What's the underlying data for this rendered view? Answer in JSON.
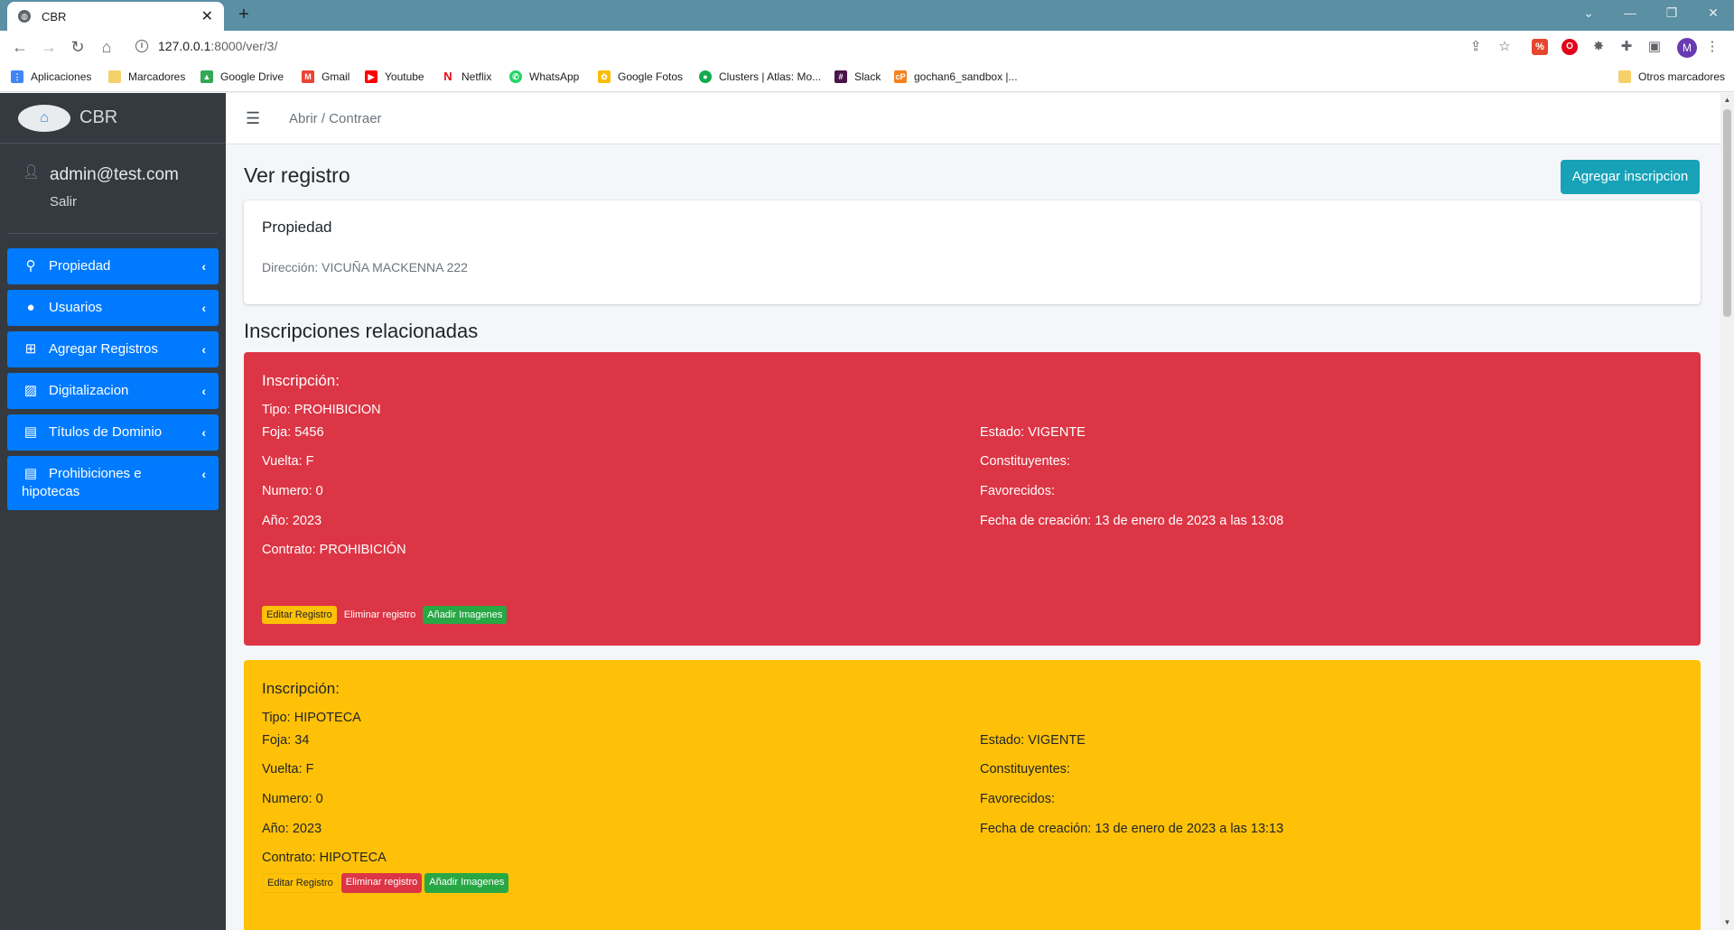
{
  "browser": {
    "tab_title": "CBR",
    "url_host": "127.0.0.1",
    "url_rest": ":8000/ver/3/",
    "bookmarks": [
      "Aplicaciones",
      "Marcadores",
      "Google Drive",
      "Gmail",
      "Youtube",
      "Netflix",
      "WhatsApp",
      "Google Fotos",
      "Clusters | Atlas: Mo...",
      "Slack",
      "gochan6_sandbox |...",
      "Otros marcadores"
    ],
    "profile_initial": "M"
  },
  "sidebar": {
    "brand": "CBR",
    "user": "admin@test.com",
    "logout": "Salir",
    "items": [
      {
        "label": "Propiedad",
        "icon": "search-icon"
      },
      {
        "label": "Usuarios",
        "icon": "user-icon"
      },
      {
        "label": "Agregar Registros",
        "icon": "plus-square-icon"
      },
      {
        "label": "Digitalizacion",
        "icon": "image-icon"
      },
      {
        "label": "Títulos de Dominio",
        "icon": "file-icon"
      },
      {
        "label": "Prohibiciones e hipotecas",
        "icon": "file-icon"
      }
    ]
  },
  "topbar": {
    "breadcrumb": "Abrir / Contraer"
  },
  "page": {
    "title": "Ver registro",
    "add_button": "Agregar inscripcion",
    "property_card": {
      "title": "Propiedad",
      "address": "Dirección: VICUÑA MACKENNA 222"
    },
    "related_title": "Inscripciones relacionadas",
    "inscriptions": [
      {
        "color": "#dc3545",
        "header": "Inscripción:",
        "tipo": "Tipo: PROHIBICION",
        "foja": "Foja: 5456",
        "vuelta": "Vuelta: F",
        "numero": "Numero: 0",
        "anio": "Año: 2023",
        "contrato": "Contrato: PROHIBICIÓN",
        "estado": "Estado: VIGENTE",
        "constituyentes": "Constituyentes:",
        "favorecidos": "Favorecidos:",
        "fecha": "Fecha de creación: 13 de enero de 2023 a las 13:08"
      },
      {
        "color": "#ffc107",
        "header": "Inscripción:",
        "tipo": "Tipo: HIPOTECA",
        "foja": "Foja: 34",
        "vuelta": "Vuelta: F",
        "numero": "Numero: 0",
        "anio": "Año: 2023",
        "contrato": "Contrato: HIPOTECA",
        "estado": "Estado: VIGENTE",
        "constituyentes": "Constituyentes:",
        "favorecidos": "Favorecidos:",
        "fecha": "Fecha de creación: 13 de enero de 2023 a las 13:13"
      }
    ],
    "actions": {
      "edit": "Editar Registro",
      "delete": "Eliminar registro",
      "images": "Añadir Imagenes"
    }
  }
}
